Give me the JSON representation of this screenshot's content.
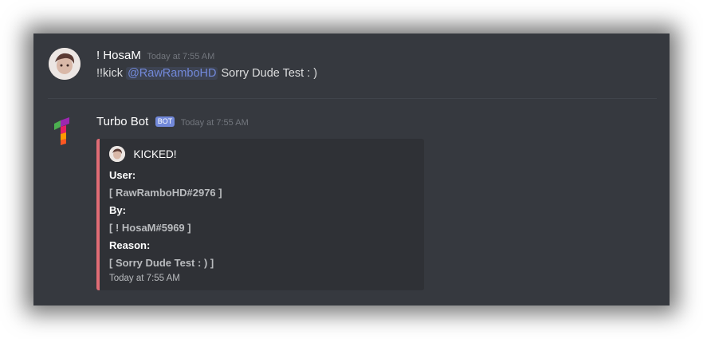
{
  "message1": {
    "username": "! HosaM",
    "timestamp": "Today at 7:55 AM",
    "content_prefix": "!!kick",
    "mention": "@RawRamboHD",
    "content_suffix": "Sorry Dude Test : )"
  },
  "message2": {
    "username": "Turbo Bot",
    "bot_tag": "BOT",
    "timestamp": "Today at 7:55 AM",
    "embed": {
      "author": "KICKED!",
      "accent_color": "#e06c75",
      "fields": [
        {
          "label": "User:",
          "value": "[ RawRamboHD#2976 ]"
        },
        {
          "label": "By:",
          "value": "[ ! HosaM#5969 ]"
        },
        {
          "label": "Reason:",
          "value": "[ Sorry Dude Test : ) ]"
        }
      ],
      "footer": "Today at 7:55 AM"
    }
  },
  "colors": {
    "background": "#36393f",
    "embed_background": "#2f3136",
    "mention": "#7289da",
    "bot_tag": "#7289da"
  }
}
